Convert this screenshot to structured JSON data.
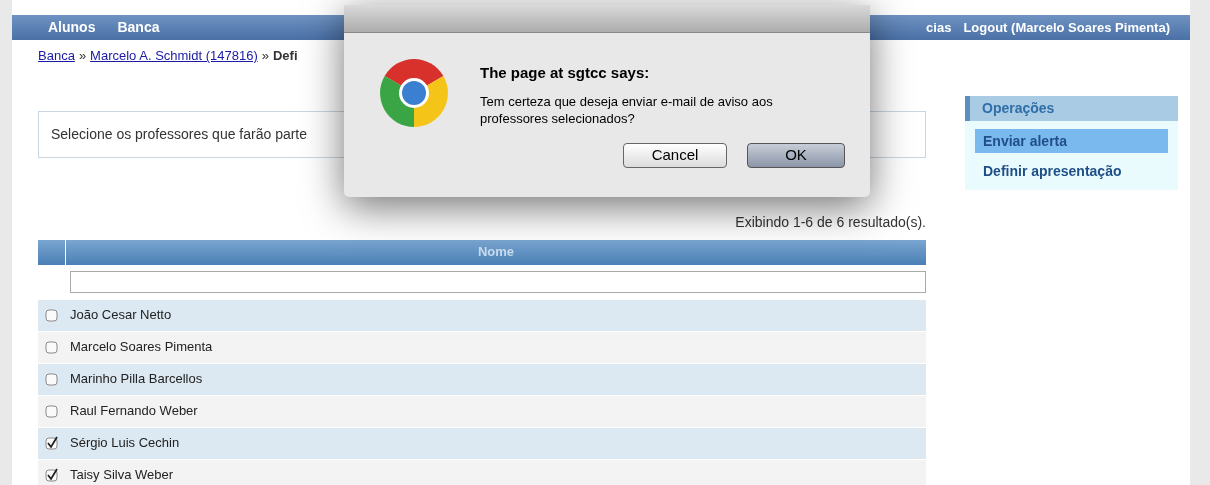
{
  "nav": {
    "items": [
      {
        "label": "Alunos"
      },
      {
        "label": "Banca"
      }
    ],
    "right_items": [
      {
        "label": "cias"
      },
      {
        "label": "Logout (Marcelo Soares Pimenta)"
      }
    ]
  },
  "breadcrumb": {
    "separator": "»",
    "items": [
      {
        "label": "Banca",
        "kind": "link"
      },
      {
        "label": "Marcelo A. Schmidt (147816)",
        "kind": "link"
      },
      {
        "label": "Defi",
        "kind": "current"
      }
    ]
  },
  "instructions": "Selecione os professores que farão parte",
  "results": "Exibindo 1-6 de 6 resultado(s).",
  "table": {
    "columns": [
      "Nome"
    ],
    "rows": [
      {
        "name": "João Cesar Netto",
        "checked": false
      },
      {
        "name": "Marcelo Soares Pimenta",
        "checked": false
      },
      {
        "name": "Marinho Pilla Barcellos",
        "checked": false
      },
      {
        "name": "Raul Fernando Weber",
        "checked": false
      },
      {
        "name": "Sérgio Luis Cechin",
        "checked": true
      },
      {
        "name": "Taisy Silva Weber",
        "checked": true
      }
    ]
  },
  "operations": {
    "title": "Operações",
    "items": [
      {
        "label": "Enviar alerta",
        "selected": true
      },
      {
        "label": "Definir apresentação",
        "selected": false
      }
    ]
  },
  "dialog": {
    "title": "The page at sgtcc says:",
    "message": "Tem certeza que deseja enviar e-mail de aviso aos professores selecionados?",
    "buttons": [
      {
        "label": "Cancel",
        "default": false
      },
      {
        "label": "OK",
        "default": true
      }
    ]
  }
}
